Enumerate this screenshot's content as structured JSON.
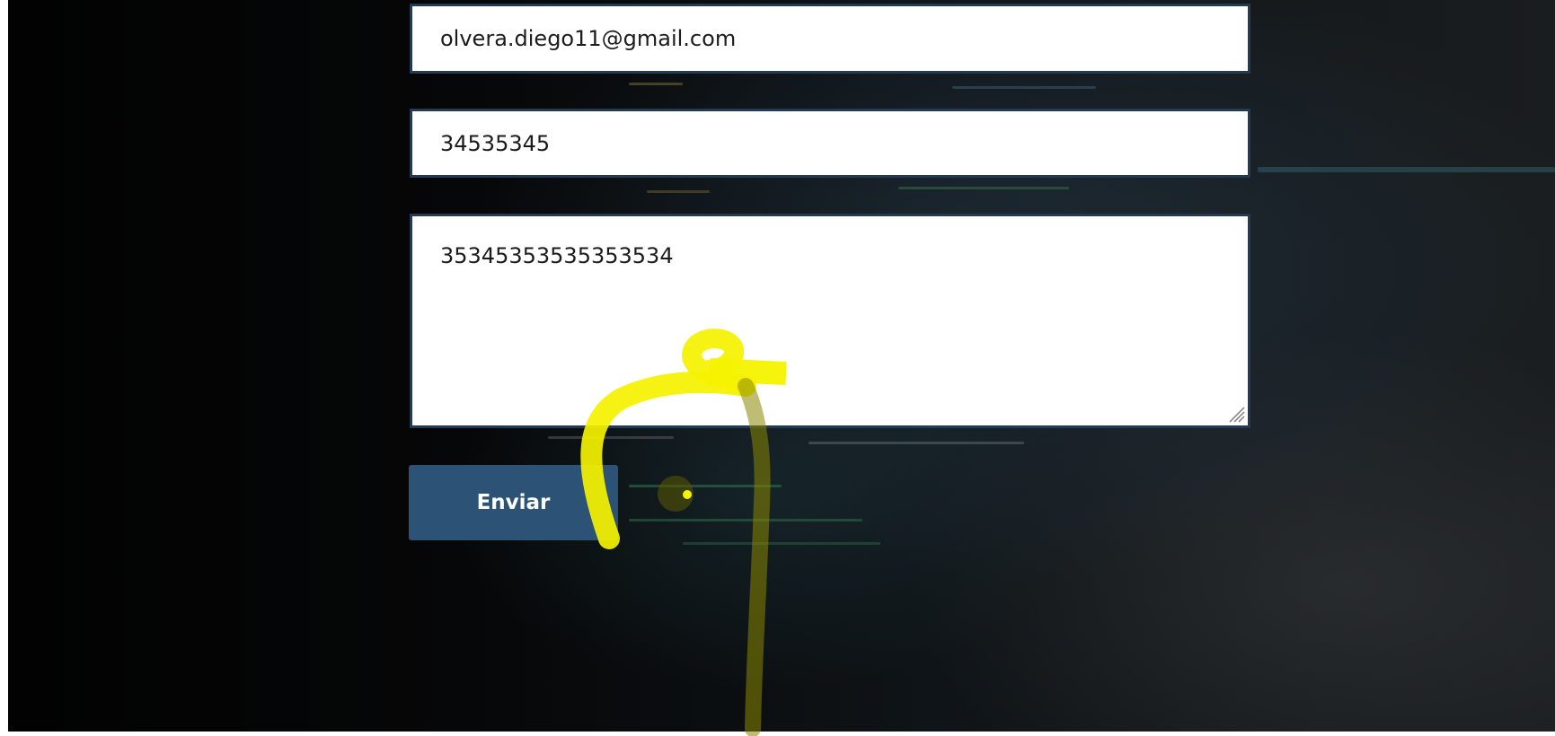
{
  "form": {
    "email_value": "olvera.diego11@gmail.com",
    "phone_value": "34535345",
    "message_value": "35345353535353534",
    "submit_label": "Enviar"
  },
  "colors": {
    "field_border": "#243a52",
    "button_background": "#2c5375",
    "button_text": "#ffffff",
    "annotation_stroke": "#f5f200"
  },
  "icons": {
    "resize": "resize-grip-icon",
    "cursor": "cursor-highlight-icon"
  }
}
